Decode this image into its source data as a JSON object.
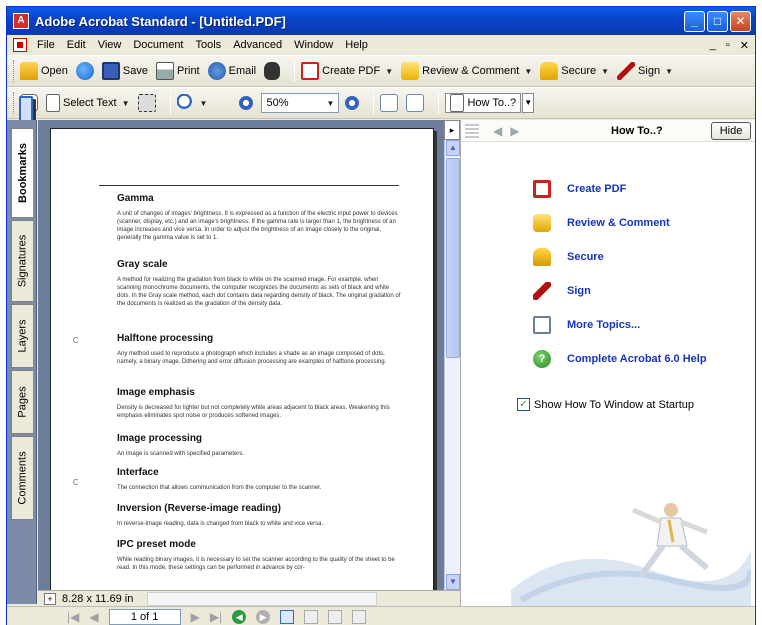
{
  "window": {
    "title": "Adobe Acrobat Standard - [Untitled.PDF]",
    "app_icon": "acrobat-icon",
    "controls": [
      "minimize",
      "maximize",
      "close"
    ]
  },
  "menu": {
    "items": [
      "File",
      "Edit",
      "View",
      "Document",
      "Tools",
      "Advanced",
      "Window",
      "Help"
    ],
    "mdi_controls": [
      "_",
      "▫",
      "✕"
    ]
  },
  "toolbar1": {
    "open": "Open",
    "save": "Save",
    "print": "Print",
    "email": "Email",
    "create_pdf": "Create PDF",
    "review": "Review & Comment",
    "secure": "Secure",
    "sign": "Sign"
  },
  "toolbar2": {
    "select_text": "Select Text",
    "zoom": "50%",
    "how_to": "How To..?"
  },
  "nav_tabs": [
    "Bookmarks",
    "Signatures",
    "Layers",
    "Pages",
    "Comments"
  ],
  "document": {
    "entries": [
      {
        "title": "Gamma",
        "body": "A unit of changes of images' brightness. It is expressed as a function of the electric input power to devices (scanner, display, etc.) and an image's brightness. If the gamma rate is larger than 1, the brightness of an image increases and vice versa. In order to adjust the brightness of an image closely to the original, generally the gamma value is set to 1."
      },
      {
        "title": "Gray scale",
        "body": "A method for realizing the gradation from black to white on the scanned image. For example, when scanning monochrome documents, the computer recognizes the documents as sets of black and white dots. In the Gray scale method, each dot contains data regarding density of black. The original gradation of the documents is realized as the gradation of the density data."
      },
      {
        "title": "Halftone processing",
        "body": "Any method used to reproduce a photograph which includes a shade as an image composed of dots, namely, a binary image. Dithering and error diffusion processing are examples of halftone processing."
      },
      {
        "title": "Image emphasis",
        "body": "Density is decreased for lighter but not completely white areas adjacent to black areas. Weakening this emphasis eliminates spot noise or produces softened images."
      },
      {
        "title": "Image processing",
        "body": "An image is scanned with specified parameters."
      },
      {
        "title": "Interface",
        "body": "The connection that allows communication from the computer to the scanner."
      },
      {
        "title": "Inversion (Reverse-image reading)",
        "body": "In reverse-image reading, data is changed from black to white and vice versa."
      },
      {
        "title": "IPC preset mode",
        "body": "While reading binary images, it is necessary to set the scanner according to the quality of the sheet to be read. In this mode, these settings can be performed in advance by cor-"
      }
    ]
  },
  "status": {
    "page_size": "8.28 x 11.69 in",
    "page_field": "1 of 1"
  },
  "howto": {
    "title": "How To..?",
    "hide": "Hide",
    "topics": [
      {
        "label": "Create PDF",
        "icon": "create-pdf-icon"
      },
      {
        "label": "Review & Comment",
        "icon": "review-comment-icon"
      },
      {
        "label": "Secure",
        "icon": "lock-icon"
      },
      {
        "label": "Sign",
        "icon": "pen-icon"
      },
      {
        "label": "More Topics...",
        "icon": "topics-icon"
      },
      {
        "label": "Complete Acrobat 6.0 Help",
        "icon": "help-icon"
      }
    ],
    "startup_label": "Show How To Window at Startup",
    "startup_checked": true
  },
  "colors": {
    "titlebar": "#0a3ab6",
    "link": "#1535b8",
    "doc_background": "#6c7d9b"
  }
}
